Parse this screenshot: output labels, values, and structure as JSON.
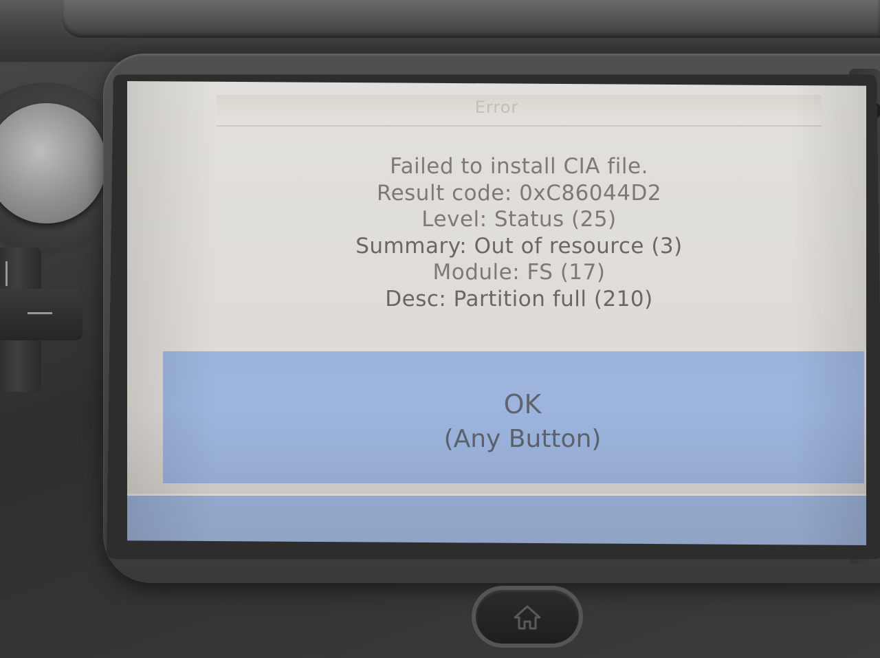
{
  "dialog": {
    "title": "Error",
    "lines": [
      "Failed to install CIA file.",
      "Result code: 0xC86044D2",
      "Level: Status (25)",
      "Summary: Out of resource (3)",
      "Module: FS (17)",
      "Desc: Partition full (210)"
    ],
    "ok_label": "OK",
    "ok_sub": "(Any Button)"
  },
  "colors": {
    "screen_background": "#dedbd6",
    "ok_panel": "#9db5de",
    "text": "#7d7a75"
  },
  "icons": {
    "home": "home-icon",
    "circle_pad": "circle-pad",
    "dpad": "dpad"
  }
}
